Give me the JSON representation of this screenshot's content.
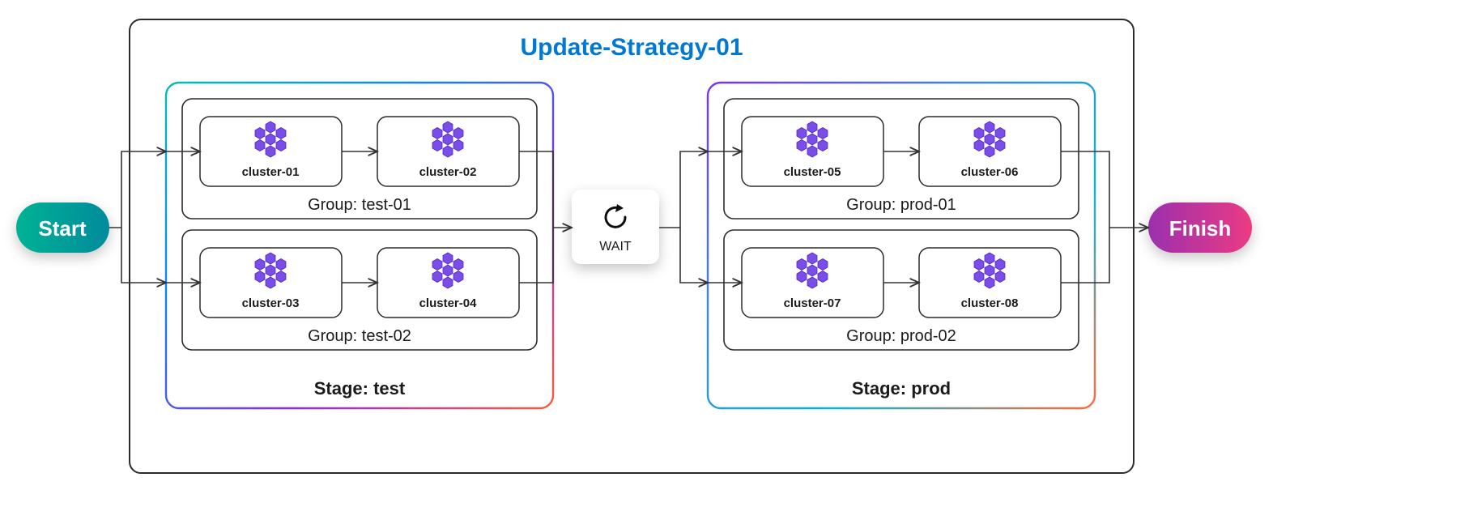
{
  "strategy": {
    "title": "Update-Strategy-01"
  },
  "pills": {
    "start": "Start",
    "finish": "Finish"
  },
  "wait": {
    "label": "WAIT"
  },
  "stages": [
    {
      "label": "Stage: test",
      "groups": [
        {
          "label": "Group: test-01",
          "clusters": [
            {
              "name": "cluster-01"
            },
            {
              "name": "cluster-02"
            }
          ]
        },
        {
          "label": "Group: test-02",
          "clusters": [
            {
              "name": "cluster-03"
            },
            {
              "name": "cluster-04"
            }
          ]
        }
      ]
    },
    {
      "label": "Stage: prod",
      "groups": [
        {
          "label": "Group: prod-01",
          "clusters": [
            {
              "name": "cluster-05"
            },
            {
              "name": "cluster-06"
            }
          ]
        },
        {
          "label": "Group: prod-02",
          "clusters": [
            {
              "name": "cluster-07"
            },
            {
              "name": "cluster-08"
            }
          ]
        }
      ]
    }
  ]
}
